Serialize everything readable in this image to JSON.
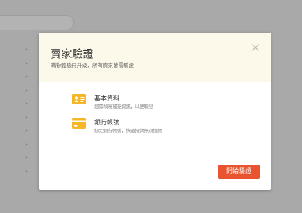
{
  "background": {
    "chevron": "›",
    "chevron_count": 10
  },
  "modal": {
    "title": "賣家驗證",
    "subtitle": "購物體驗再升級，所有賣家皆需驗證",
    "close_icon": "close-icon",
    "steps": [
      {
        "icon": "id-card-icon",
        "title": "基本資料",
        "description": "您需填寫補充資訊，以便驗證"
      },
      {
        "icon": "bank-card-icon",
        "title": "銀行帳號",
        "description": "綁定銀行帳號，快速撥款無須換帳"
      }
    ],
    "start_button_label": "開始驗證"
  },
  "colors": {
    "overlay": "#a9a9a9",
    "header_bg": "#fcf8ea",
    "icon_accent": "#f5b727",
    "primary_button": "#e8542f"
  }
}
